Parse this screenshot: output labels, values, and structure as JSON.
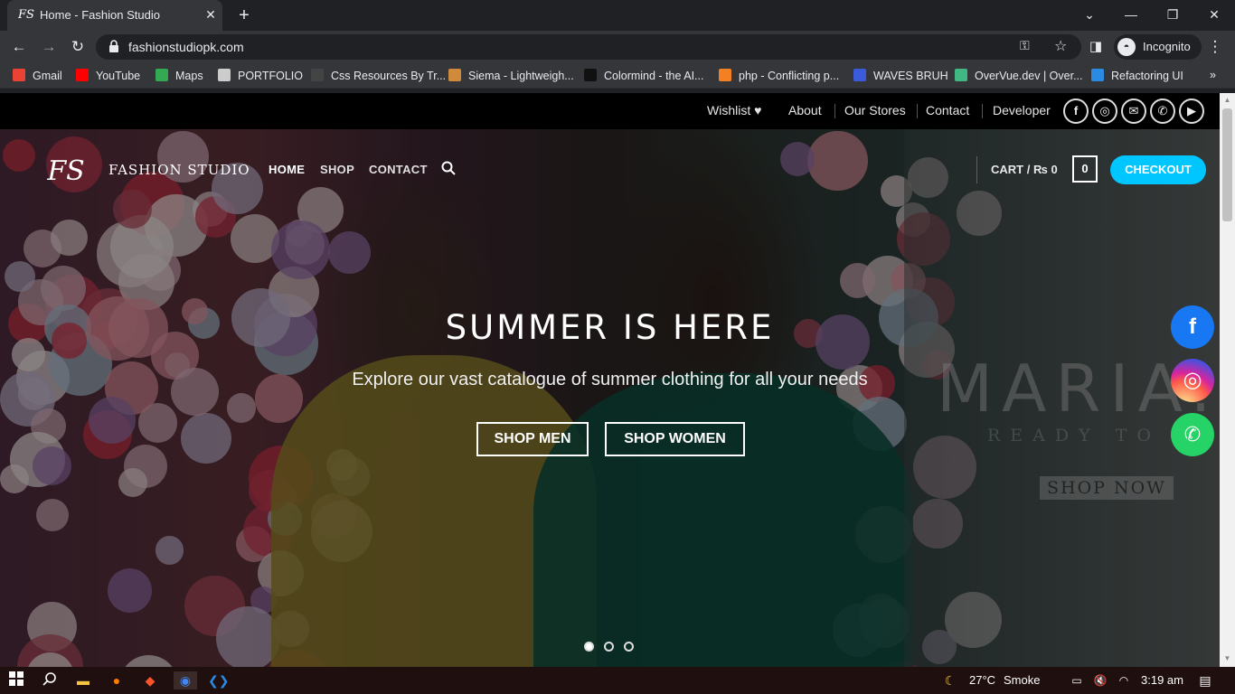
{
  "browser": {
    "tab_title": "Home - Fashion Studio",
    "tab_favicon": "FS",
    "close_tab": "✕",
    "new_tab": "+",
    "url": "fashionstudiopk.com",
    "incognito_label": "Incognito",
    "window_controls": [
      "⌄",
      "—",
      "❐",
      "✕"
    ]
  },
  "bookmarks": [
    {
      "label": "Gmail",
      "color": "#ea4335"
    },
    {
      "label": "YouTube",
      "color": "#ff0000"
    },
    {
      "label": "Maps",
      "color": "#34a853"
    },
    {
      "label": "PORTFOLIO",
      "color": "#cccccc"
    },
    {
      "label": "Css Resources By Tr...",
      "color": "#444444"
    },
    {
      "label": "Siema - Lightweigh...",
      "color": "#d08a3c"
    },
    {
      "label": "Colormind - the AI...",
      "color": "#111111"
    },
    {
      "label": "php - Conflicting p...",
      "color": "#f48024"
    },
    {
      "label": "WAVES BRUH",
      "color": "#3b5bdb"
    },
    {
      "label": "OverVue.dev | Over...",
      "color": "#41b883"
    },
    {
      "label": "Refactoring UI",
      "color": "#2b8ae2"
    }
  ],
  "topbar": {
    "links": [
      "Wishlist ♥",
      "About",
      "Our Stores",
      "Contact",
      "Developer"
    ],
    "social_icons": [
      "f",
      "◎",
      "✉",
      "✆",
      "▶"
    ]
  },
  "header": {
    "logo": "FS",
    "brand": "FASHION STUDIO",
    "nav": [
      "HOME",
      "SHOP",
      "CONTACT"
    ],
    "cart_label": "CART / ₨ 0",
    "cart_count": "0",
    "checkout": "CHECKOUT"
  },
  "hero": {
    "title": "SUMMER IS HERE",
    "subtitle": "Explore our vast catalogue of summer clothing for all your needs",
    "buttons": [
      "SHOP MEN",
      "SHOP WOMEN"
    ],
    "background_text": {
      "maria": "MARIA.",
      "ready": "READY TO W",
      "shop_now": "SHOP NOW"
    },
    "slide_dots": 3,
    "active_slide": 1
  },
  "floating_social": [
    {
      "icon": "f",
      "color": "#1877f2"
    },
    {
      "icon": "◎",
      "color": "#d6249f"
    },
    {
      "icon": "✆",
      "color": "#25d366"
    }
  ],
  "taskbar": {
    "weather": "27°C",
    "weather_label": "Smoke",
    "time": "3:19 am"
  }
}
